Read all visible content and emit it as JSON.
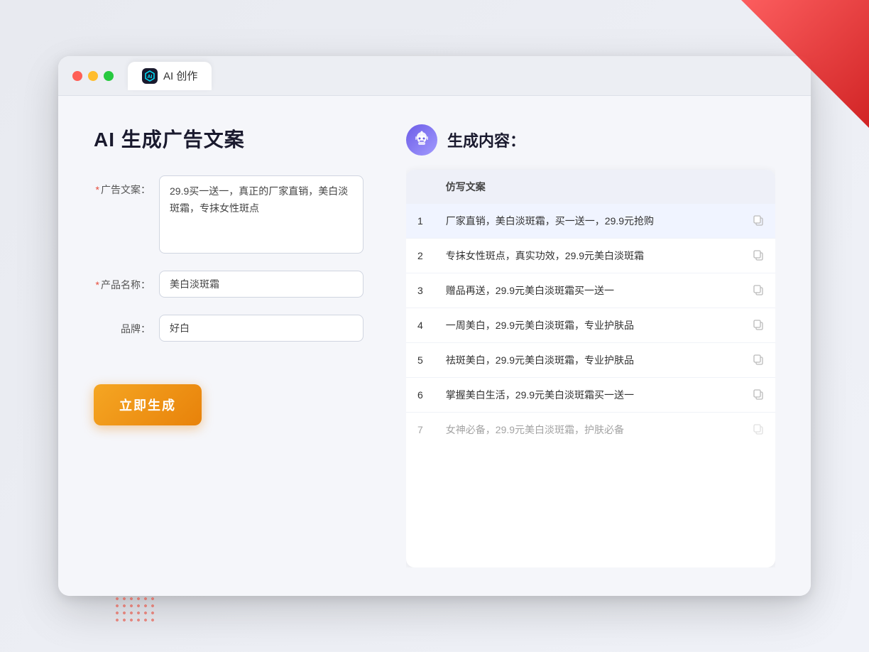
{
  "window": {
    "tab_icon_label": "AI",
    "tab_label": "AI 创作"
  },
  "left_panel": {
    "page_title": "AI 生成广告文案",
    "fields": [
      {
        "id": "ad_copy",
        "label": "广告文案：",
        "required": true,
        "type": "textarea",
        "value": "29.9买一送一，真正的厂家直销，美白淡斑霜，专抹女性斑点",
        "placeholder": ""
      },
      {
        "id": "product_name",
        "label": "产品名称：",
        "required": true,
        "type": "input",
        "value": "美白淡斑霜",
        "placeholder": ""
      },
      {
        "id": "brand",
        "label": "品牌：",
        "required": false,
        "type": "input",
        "value": "好白",
        "placeholder": ""
      }
    ],
    "generate_button_label": "立即生成"
  },
  "right_panel": {
    "robot_emoji": "🤖",
    "result_title": "生成内容：",
    "table_header": "仿写文案",
    "results": [
      {
        "index": 1,
        "text": "厂家直销，美白淡斑霜，买一送一，29.9元抢购",
        "faded": false
      },
      {
        "index": 2,
        "text": "专抹女性斑点，真实功效，29.9元美白淡斑霜",
        "faded": false
      },
      {
        "index": 3,
        "text": "赠品再送，29.9元美白淡斑霜买一送一",
        "faded": false
      },
      {
        "index": 4,
        "text": "一周美白，29.9元美白淡斑霜，专业护肤品",
        "faded": false
      },
      {
        "index": 5,
        "text": "祛斑美白，29.9元美白淡斑霜，专业护肤品",
        "faded": false
      },
      {
        "index": 6,
        "text": "掌握美白生活，29.9元美白淡斑霜买一送一",
        "faded": false
      },
      {
        "index": 7,
        "text": "女神必备，29.9元美白淡斑霜，护肤必备",
        "faded": true
      }
    ]
  },
  "colors": {
    "accent_orange": "#e8820a",
    "accent_purple": "#6c5ce7",
    "required_red": "#e74c3c"
  }
}
